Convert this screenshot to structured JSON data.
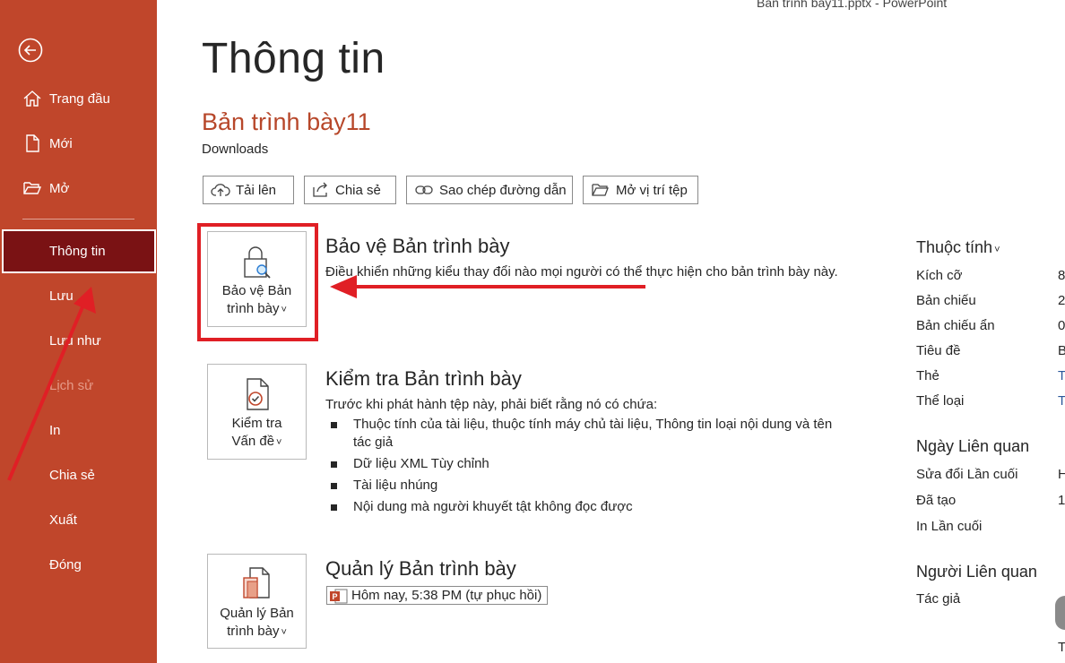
{
  "window": {
    "title": "Bản trình bày11.pptx  -  PowerPoint"
  },
  "sidebar": {
    "items": [
      {
        "label": "Trang đầu",
        "icon": "home-icon"
      },
      {
        "label": "Mới",
        "icon": "new-document-icon"
      },
      {
        "label": "Mở",
        "icon": "open-folder-icon"
      },
      {
        "label": "Thông tin",
        "selected": true
      },
      {
        "label": "Lưu"
      },
      {
        "label": "Lưu như"
      },
      {
        "label": "Lịch sử",
        "disabled": true
      },
      {
        "label": "In"
      },
      {
        "label": "Chia sẻ"
      },
      {
        "label": "Xuất"
      },
      {
        "label": "Đóng"
      }
    ]
  },
  "main": {
    "page_title": "Thông tin",
    "document_title": "Bản trình bày11",
    "document_location": "Downloads",
    "actions": [
      {
        "label": "Tải lên",
        "icon": "cloud-upload-icon"
      },
      {
        "label": "Chia sẻ",
        "icon": "share-icon"
      },
      {
        "label": "Sao chép đường dẫn",
        "icon": "link-icon"
      },
      {
        "label": "Mở vị trí tệp",
        "icon": "folder-icon"
      }
    ],
    "protect": {
      "tile_line1": "Bảo vệ Bản",
      "tile_line2": "trình bày",
      "title": "Bảo vệ Bản trình bày",
      "description": "Điều khiển những kiểu thay đổi nào mọi người có thể thực hiện cho bản trình bày này."
    },
    "inspect": {
      "tile_line1": "Kiểm tra",
      "tile_line2": "Vấn đề",
      "title": "Kiểm tra Bản trình bày",
      "description": "Trước khi phát hành tệp này, phải biết rằng nó có chứa:",
      "bullets": [
        "Thuộc tính của tài liệu, thuộc tính máy chủ tài liệu, Thông tin loại nội dung và tên tác giả",
        "Dữ liệu XML Tùy chỉnh",
        "Tài liệu nhúng",
        "Nội dung mà người khuyết tật không đọc được"
      ]
    },
    "manage": {
      "tile_line1": "Quản lý Bản",
      "tile_line2": "trình bày",
      "title": "Quản lý Bản trình bày",
      "version": "Hôm nay, 5:38 PM (tự phục hồi)"
    }
  },
  "properties": {
    "heading": "Thuộc tính",
    "rows": [
      {
        "label": "Kích cỡ",
        "value": "8"
      },
      {
        "label": "Bản chiếu",
        "value": "2"
      },
      {
        "label": "Bản chiếu ẩn",
        "value": "0"
      },
      {
        "label": "Tiêu đề",
        "value": "B"
      },
      {
        "label": "Thẻ",
        "value": "T"
      },
      {
        "label": "Thể loại",
        "value": "T"
      }
    ],
    "dates_heading": "Ngày Liên quan",
    "dates": [
      {
        "label": "Sửa đổi Lần cuối",
        "value": "H"
      },
      {
        "label": "Đã tạo",
        "value": "1"
      },
      {
        "label": "In Lần cuối",
        "value": ""
      }
    ],
    "people_heading": "Người Liên quan",
    "people": [
      {
        "label": "Tác giả",
        "value": ""
      }
    ],
    "footer_value": "T"
  },
  "colors": {
    "sidebar_bg": "#c0462b",
    "selected_bg": "#7a1214",
    "accent_text": "#b7472a",
    "annotation_red": "#e01f25"
  }
}
